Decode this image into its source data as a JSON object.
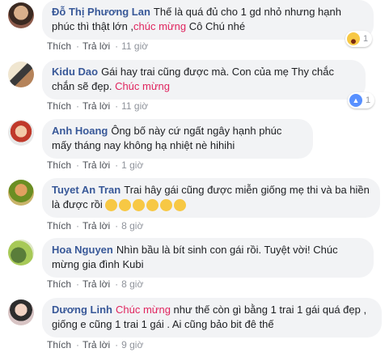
{
  "comments": [
    {
      "name": "Đỗ Thị Phương Lan",
      "text_before": "Thế là quá đủ cho 1 gd nhỏ nhưng hạnh phúc thì thật lớn ,",
      "highlight": "chúc mừng",
      "text_after": " Cô Chú nhé",
      "like": "Thích",
      "reply": "Trả lời",
      "time": "11 giờ",
      "reaction_count": "1",
      "reaction": "haha-icon"
    },
    {
      "name": "Kidu Dao",
      "text_before": "Gái hay trai cũng được mà. Con của mẹ Thy chắc chắn sẽ đẹp. ",
      "highlight": "Chúc mừng",
      "text_after": "",
      "like": "Thích",
      "reply": "Trả lời",
      "time": "11 giờ",
      "reaction_count": "1",
      "reaction": "like-icon"
    },
    {
      "name": "Anh Hoang",
      "text_before": "Ông bố này cứ ngất ngây hạnh phúc mấy tháng nay không hạ nhiệt nè hihihi",
      "highlight": "",
      "text_after": "",
      "like": "Thích",
      "reply": "Trả lời",
      "time": "1 giờ"
    },
    {
      "name": "Tuyet An Tran",
      "text_before": "Trai hây gái cũng được miễn giống mẹ thi và ba hiền là được rồi ",
      "highlight": "",
      "text_after": "",
      "like": "Thích",
      "reply": "Trả lời",
      "time": "8 giờ"
    },
    {
      "name": "Hoa Nguyen",
      "text_before": "Nhìn bầu là bít sinh con gái rồi. Tuyệt vời! Chúc mừng gia đình Kubi",
      "highlight": "",
      "text_after": "",
      "like": "Thích",
      "reply": "Trả lời",
      "time": "8 giờ"
    },
    {
      "name": "Dương Linh",
      "text_before": "",
      "highlight": "Chúc mừng",
      "text_after": " như thế còn gì bằng 1 trai 1 gái quá đẹp , giống e cũng 1 trai 1 gái . Ai cũng bảo bit đê thế",
      "like": "Thích",
      "reply": "Trả lời",
      "time": "9 giờ"
    }
  ],
  "colors": {
    "name": "#385898",
    "highlight": "#e0245e",
    "bubble": "#f2f3f5",
    "meta": "#90949c"
  }
}
